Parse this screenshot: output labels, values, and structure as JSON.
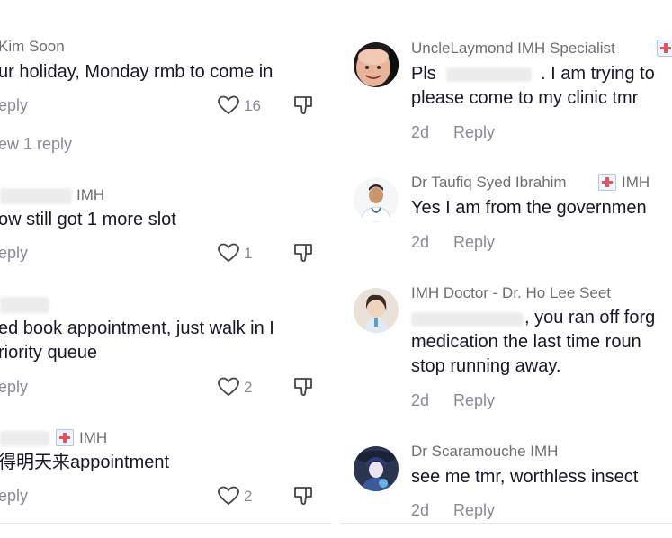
{
  "left": {
    "comments": [
      {
        "name": "Kim Soon",
        "text": "ur holiday, Monday rmb to come in",
        "reply": "eply",
        "likes": "16"
      },
      {
        "view_replies": "ew 1 reply"
      },
      {
        "name_suffix": "IMH",
        "text": "ow still got 1 more slot",
        "reply": "eply",
        "likes": "1"
      },
      {
        "text_line1": "ed book appointment, just walk in I",
        "text_line2": "riority queue",
        "reply": "eply",
        "likes": "2"
      },
      {
        "name_suffix": "IMH",
        "text": "得明天来appointment",
        "reply": "eply",
        "likes": "2"
      }
    ]
  },
  "right": {
    "comments": [
      {
        "name": "UncleLaymond IMH Specialist",
        "text_line1_a": "Pls",
        "text_line1_b": ". I am trying to",
        "text_line2": "please come to my clinic tmr",
        "time": "2d",
        "reply": "Reply"
      },
      {
        "name": "Dr Taufiq Syed Ibrahim",
        "name_suffix": "IMH",
        "text": "Yes I am from the governmen",
        "time": "2d",
        "reply": "Reply"
      },
      {
        "name": "IMH Doctor - Dr. Ho Lee Seet",
        "text_line1": ", you ran off forg",
        "text_line2": "medication the last time roun",
        "text_line3": "stop running away.",
        "time": "2d",
        "reply": "Reply"
      },
      {
        "name": "Dr Scaramouche IMH",
        "text": "see me tmr, worthless insect",
        "time": "2d",
        "reply": "Reply"
      }
    ]
  },
  "colors": {
    "text": "#161823",
    "secondary": "#8a8b91",
    "name": "#6f6f73"
  },
  "icons": [
    "heart-icon",
    "dislike-icon",
    "medical-badge-icon"
  ]
}
